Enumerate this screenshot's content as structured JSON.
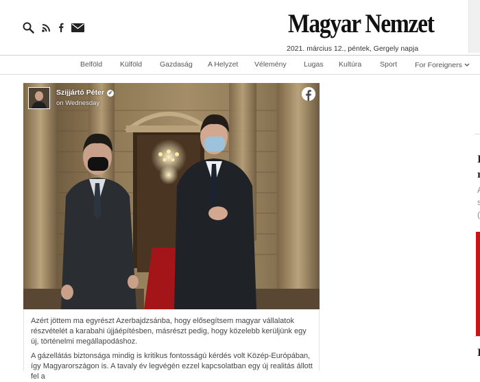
{
  "header": {
    "logo": "Magyar Nemzet",
    "dateline": "2021. március 12., péntek, Gergely napja",
    "icons": [
      "search-icon",
      "rss-icon",
      "facebook-icon",
      "mail-icon"
    ]
  },
  "nav": {
    "items": [
      {
        "label": "Belföld"
      },
      {
        "label": "Külföld"
      },
      {
        "label": "Gazdaság"
      },
      {
        "label": "A Helyzet"
      },
      {
        "label": "Vélemény"
      },
      {
        "label": "Lugas"
      },
      {
        "label": "Kultúra"
      },
      {
        "label": "Sport"
      },
      {
        "label": "For Foreigners"
      }
    ]
  },
  "embed": {
    "author": "Szijjártó Péter",
    "time": "on Wednesday",
    "icons": [
      "verified-icon",
      "facebook-logo-icon"
    ]
  },
  "post": {
    "paragraph1": "Azért jöttem ma egyrészt Azerbajdzsánba, hogy elősegítsem magyar vállalatok részvételét a karabahi újjáépítésben, másrészt pedig, hogy közelebb kerüljünk egy új, történelmi megállapodáshoz.",
    "paragraph2": "A gázellátás biztonsága mindig is kritikus fontosságú kérdés volt Közép-Európában, így Magyarországon is. A tavaly év legvégén ezzel kapcsolatban egy új realitás állott fel a"
  },
  "right_column": {
    "fragments": [
      "I",
      "r",
      "A",
      "s",
      "(",
      "I"
    ]
  },
  "colors": {
    "accent_red": "#c81414",
    "header_border": "#cfcfcf"
  }
}
